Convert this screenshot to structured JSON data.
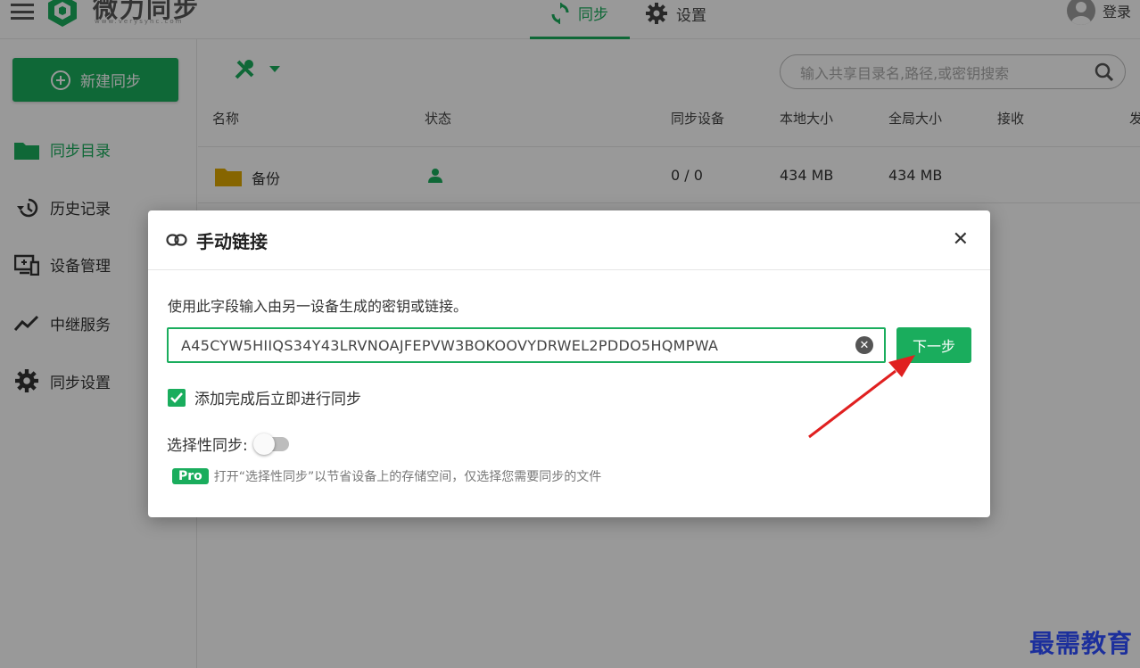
{
  "header": {
    "logo_text": "微力同步",
    "logo_sub": "www.verysync.com",
    "tab_sync": "同步",
    "tab_settings": "设置",
    "login": "登录"
  },
  "sidebar": {
    "new_sync": "新建同步",
    "items": [
      {
        "label": "同步目录",
        "icon": "folder-icon"
      },
      {
        "label": "历史记录",
        "icon": "history-icon"
      },
      {
        "label": "设备管理",
        "icon": "device-icon"
      },
      {
        "label": "中继服务",
        "icon": "relay-icon"
      },
      {
        "label": "同步设置",
        "icon": "gear-icon"
      }
    ]
  },
  "main": {
    "search_placeholder": "输入共享目录名,路径,或密钥搜索",
    "columns": [
      "名称",
      "状态",
      "同步设备",
      "本地大小",
      "全局大小",
      "接收",
      "发"
    ],
    "rows": [
      {
        "name": "备份",
        "devices": "0 / 0",
        "local": "434 MB",
        "global": "434 MB"
      }
    ]
  },
  "dialog": {
    "title": "手动链接",
    "description": "使用此字段输入由另一设备生成的密钥或链接。",
    "input_value": "A45CYW5HIIQS34Y43LRVNOAJFEPVW3BOKOOVYDRWEL2PDDO5HQMPWA",
    "next": "下一步",
    "checkbox_label": "添加完成后立即进行同步",
    "checkbox_checked": true,
    "selective_label": "选择性同步:",
    "selective_on": false,
    "pro_badge": "Pro",
    "pro_text": "打开“选择性同步”以节省设备上的存储空间，仅选择您需要同步的文件"
  },
  "colors": {
    "accent": "#1aad5d",
    "arrow": "#e02020",
    "watermark": "#1c2f9c"
  },
  "watermark": "最需教育"
}
